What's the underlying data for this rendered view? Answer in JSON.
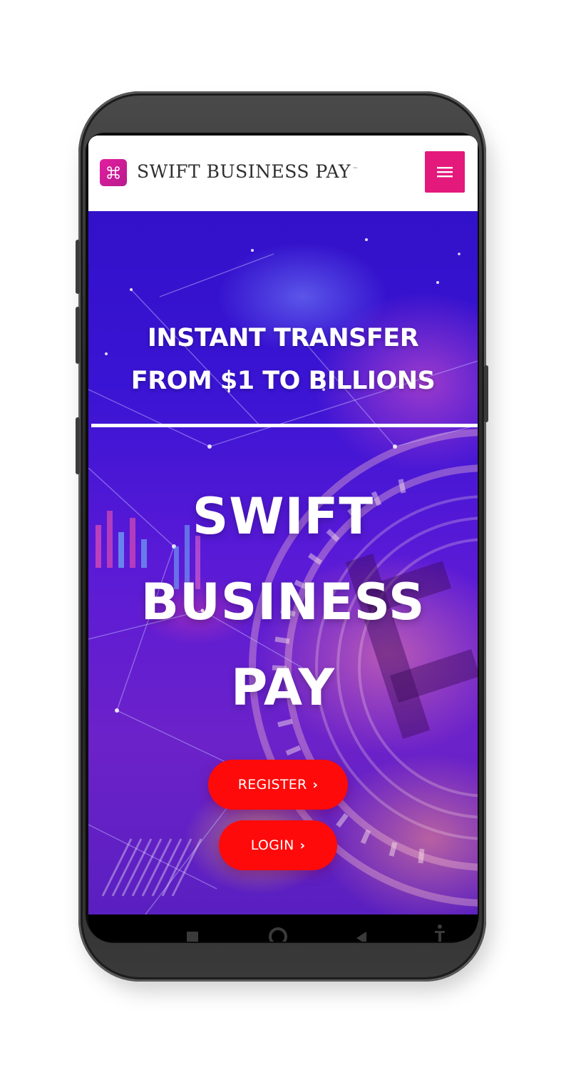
{
  "header": {
    "logo_icon": "command-key-icon",
    "brand_name": "SWIFT BUSINESS PAY",
    "brand_mark": "™",
    "menu_icon": "hamburger-menu-icon"
  },
  "hero": {
    "tagline_line1": "INSTANT TRANSFER",
    "tagline_line2": "FROM $1 TO BILLIONS",
    "title_line1": "SWIFT",
    "title_line2": "BUSINESS",
    "title_line3": "PAY",
    "register_label": "REGISTER",
    "login_label": "LOGIN",
    "button_icon": "chevron-right-icon"
  },
  "nav_bar": {
    "icons": [
      "square-recents-icon",
      "circle-home-icon",
      "triangle-back-icon",
      "accessibility-icon"
    ]
  },
  "colors": {
    "brand_pink": "#e3197c",
    "button_red": "#ff0a0a",
    "hero_blue": "#3211c9",
    "hero_purple": "#6c22c9"
  }
}
